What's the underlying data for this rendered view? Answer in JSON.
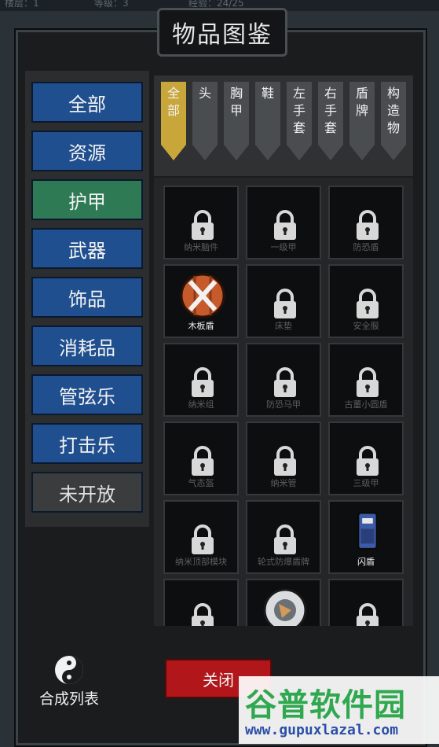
{
  "topbar": {
    "floor": "楼层：1",
    "level": "等级：3",
    "exp": "经验：24/25"
  },
  "panel": {
    "title": "物品图鉴"
  },
  "categories": [
    {
      "label": "全部",
      "state": "normal"
    },
    {
      "label": "资源",
      "state": "normal"
    },
    {
      "label": "护甲",
      "state": "active"
    },
    {
      "label": "武器",
      "state": "normal"
    },
    {
      "label": "饰品",
      "state": "normal"
    },
    {
      "label": "消耗品",
      "state": "normal"
    },
    {
      "label": "管弦乐",
      "state": "normal"
    },
    {
      "label": "打击乐",
      "state": "normal"
    },
    {
      "label": "未开放",
      "state": "locked"
    }
  ],
  "tabs": [
    {
      "label": "全\n部",
      "active": true
    },
    {
      "label": "头",
      "active": false
    },
    {
      "label": "胸\n甲",
      "active": false
    },
    {
      "label": "鞋",
      "active": false
    },
    {
      "label": "左\n手\n套",
      "active": false
    },
    {
      "label": "右\n手\n套",
      "active": false
    },
    {
      "label": "盾\n牌",
      "active": false
    },
    {
      "label": "构\n造\n物",
      "active": false
    }
  ],
  "items": [
    {
      "name": "纳米脑件",
      "locked": true
    },
    {
      "name": "一级甲",
      "locked": true
    },
    {
      "name": "防恐盾",
      "locked": true
    },
    {
      "name": "木板盾",
      "locked": false,
      "icon": "wooden-shield-icon"
    },
    {
      "name": "床垫",
      "locked": true
    },
    {
      "name": "安全服",
      "locked": true
    },
    {
      "name": "纳米组",
      "locked": true
    },
    {
      "name": "防恐马甲",
      "locked": true
    },
    {
      "name": "古董小圆盾",
      "locked": true
    },
    {
      "name": "气态盔",
      "locked": true
    },
    {
      "name": "纳米管",
      "locked": true
    },
    {
      "name": "三级甲",
      "locked": true
    },
    {
      "name": "纳米顶部模块",
      "locked": true
    },
    {
      "name": "轮式防爆盾牌",
      "locked": true
    },
    {
      "name": "闪盾",
      "locked": false,
      "icon": "flash-shield-icon"
    },
    {
      "name": "",
      "locked": true
    },
    {
      "name": "",
      "locked": false,
      "icon": "gear-shield-icon"
    },
    {
      "name": "",
      "locked": true
    }
  ],
  "buttons": {
    "close": "关闭",
    "synth": "合成列表"
  },
  "watermark": {
    "title": "谷普软件园",
    "url": "www.gupuxlazal.com"
  },
  "colors": {
    "category_blue": "#1f4f8f",
    "category_active": "#2d7a55",
    "tab_active": "#c9a63a",
    "close_red": "#b0161a"
  }
}
